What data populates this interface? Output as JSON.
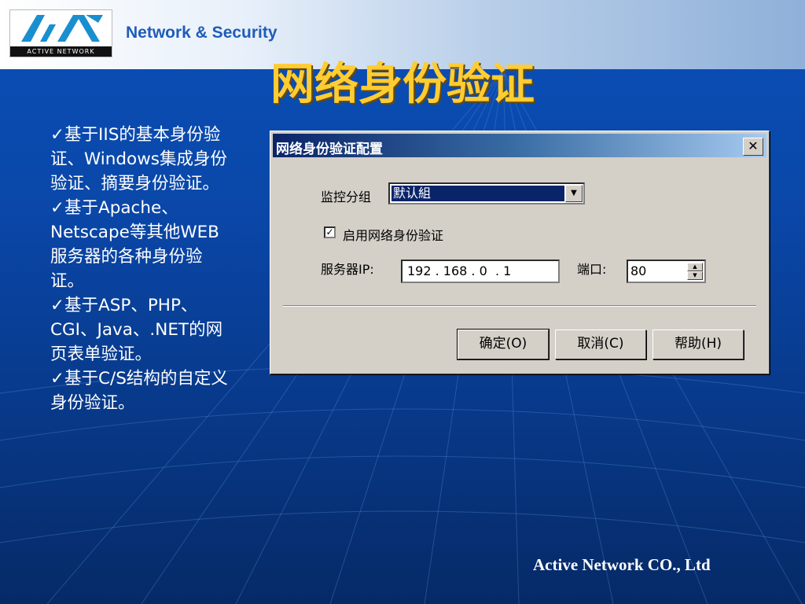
{
  "header": {
    "logo_text": "ACTIVE NETWORK",
    "title": "Network & Security"
  },
  "slide": {
    "title": "网络身份验证",
    "bullets": [
      "基于IIS的基本身份验证、Windows集成身份验证、摘要身份验证。",
      "基于Apache、Netscape等其他WEB服务器的各种身份验证。",
      "基于ASP、PHP、CGI、Java、.NET的网页表单验证。",
      "基于C/S结构的自定义身份验证。"
    ],
    "check_glyph": "✓"
  },
  "dialog": {
    "title": "网络身份验证配置",
    "close_glyph": "✕",
    "group_label": "监控分组",
    "group_value": "默认組",
    "enable_label": "启用网络身份验证",
    "enable_checked": true,
    "server_ip_label": "服务器IP:",
    "server_ip_value": "192 . 168 . 0  . 1",
    "port_label": "端口:",
    "port_value": "80",
    "buttons": {
      "ok": "确定(O)",
      "cancel": "取消(C)",
      "help": "帮助(H)"
    }
  },
  "footer": {
    "company": "Active Network CO., Ltd"
  }
}
